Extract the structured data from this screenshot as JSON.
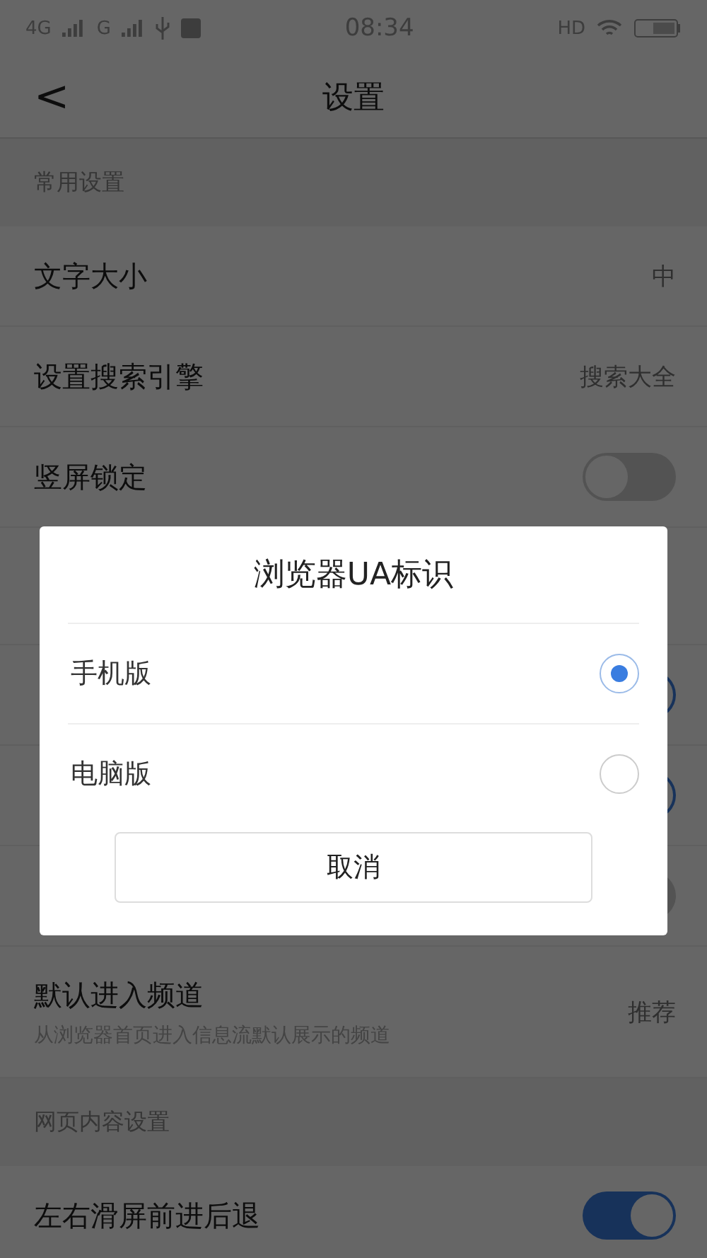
{
  "status_bar": {
    "network_1": "4G",
    "network_2": "G",
    "time": "08:34",
    "hd": "HD"
  },
  "nav": {
    "back": "<",
    "title": "设置"
  },
  "sections": [
    {
      "header": "常用设置",
      "rows": [
        {
          "kind": "value",
          "title": "文字大小",
          "value": "中"
        },
        {
          "kind": "value",
          "title": "设置搜索引擎",
          "value": "搜索大全"
        },
        {
          "kind": "toggle",
          "title": "竖屏锁定",
          "on": false
        },
        {
          "kind": "hidden"
        },
        {
          "kind": "toggle",
          "on": true
        },
        {
          "kind": "toggle",
          "on": true
        },
        {
          "kind": "toggle",
          "on": false
        },
        {
          "kind": "value",
          "title": "默认进入频道",
          "subtitle": "从浏览器首页进入信息流默认展示的频道",
          "value": "推荐"
        }
      ]
    },
    {
      "header": "网页内容设置",
      "rows": [
        {
          "kind": "toggle",
          "title": "左右滑屏前进后退",
          "on": true
        }
      ]
    }
  ],
  "dialog": {
    "title": "浏览器UA标识",
    "options": [
      {
        "label": "手机版",
        "selected": true
      },
      {
        "label": "电脑版",
        "selected": false
      }
    ],
    "cancel": "取消"
  }
}
